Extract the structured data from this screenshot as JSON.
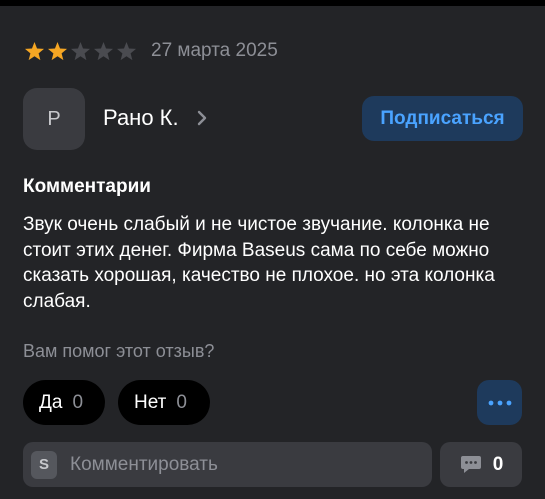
{
  "review": {
    "rating": 2,
    "rating_max": 5,
    "date": "27 марта 2025",
    "colors": {
      "star_filled": "#f5a623",
      "star_empty": "#4a4b50"
    }
  },
  "author": {
    "initial": "Р",
    "name": "Рано К.",
    "chevron_icon": "chevron-right-icon",
    "subscribe_label": "Подписаться"
  },
  "comment_section": {
    "title": "Комментарии",
    "text": "Звук очень слабый и не чистое звучание. колонка не стоит этих денег. Фирма Baseus сама по себе можно сказать хорошая, качество не плохое. но эта колонка слабая."
  },
  "helpful": {
    "question": "Вам помог этот отзыв?",
    "yes_label": "Да",
    "yes_count": "0",
    "no_label": "Нет",
    "no_count": "0",
    "more_icon": "more-dots-icon"
  },
  "comment_input": {
    "badge": "S",
    "placeholder": "Комментировать",
    "comments_icon": "chat-bubble-icon",
    "comments_count": "0"
  },
  "accent": {
    "blue": "#4aa3ff",
    "blue_bg": "#1e3a5c"
  }
}
